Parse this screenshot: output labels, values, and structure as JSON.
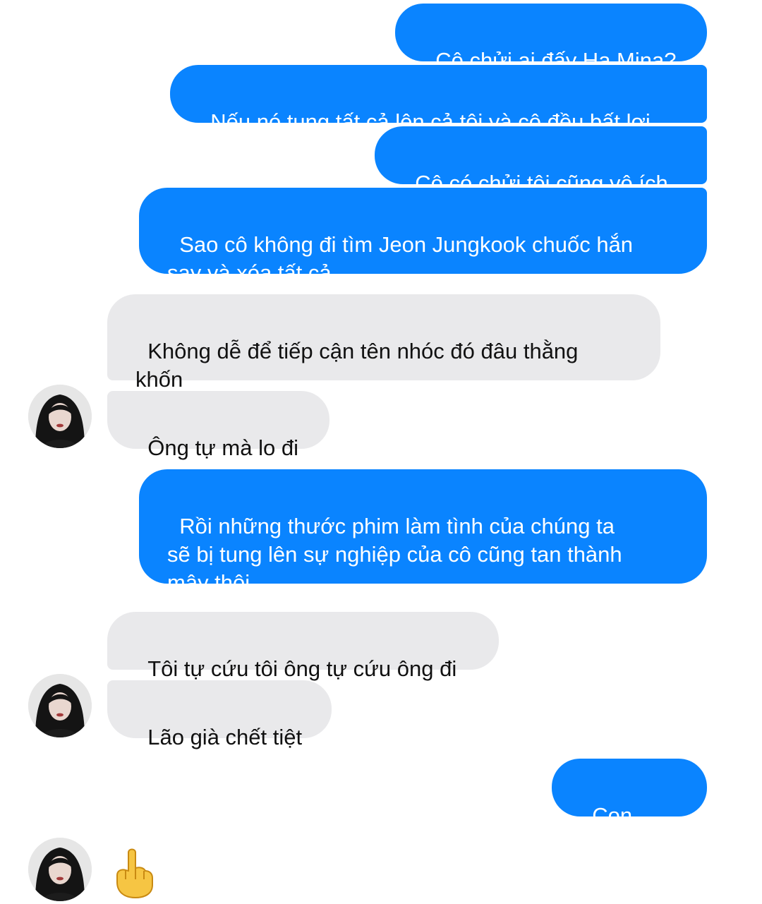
{
  "conversation": {
    "messages": [
      {
        "side": "out",
        "text": "Cô chửi ai đấy Ha Mina?"
      },
      {
        "side": "out",
        "text": "Nếu nó tung tất cả lên cả tôi và cô đều bất lợi"
      },
      {
        "side": "out",
        "text": "Cô có chửi tôi cũng vô ích"
      },
      {
        "side": "out",
        "text": "Sao cô không đi tìm Jeon Jungkook chuốc hắn\nsay và xóa tất cả"
      },
      {
        "side": "in",
        "text": "Không dễ để tiếp cận tên nhóc đó đâu thằng\nkhốn"
      },
      {
        "side": "in",
        "text": "Ông tự mà lo đi"
      },
      {
        "side": "out",
        "text": "Rồi những thước phim làm tình của chúng ta\nsẽ bị tung lên sự nghiệp của cô cũng tan thành\nmây thôi"
      },
      {
        "side": "in",
        "text": "Tôi tự cứu tôi ông tự cứu ông đi"
      },
      {
        "side": "in",
        "text": "Lão già chết tiệt"
      },
      {
        "side": "out",
        "text": "Con khốn"
      },
      {
        "side": "in",
        "kind": "emoji",
        "icon": "middle-finger-emoji",
        "text": "🖕"
      }
    ]
  },
  "colors": {
    "outgoing_bubble": "#0a84ff",
    "incoming_bubble": "#e9e9eb",
    "outgoing_text": "#ffffff",
    "incoming_text": "#111111"
  },
  "avatar": {
    "icon": "contact-avatar"
  }
}
